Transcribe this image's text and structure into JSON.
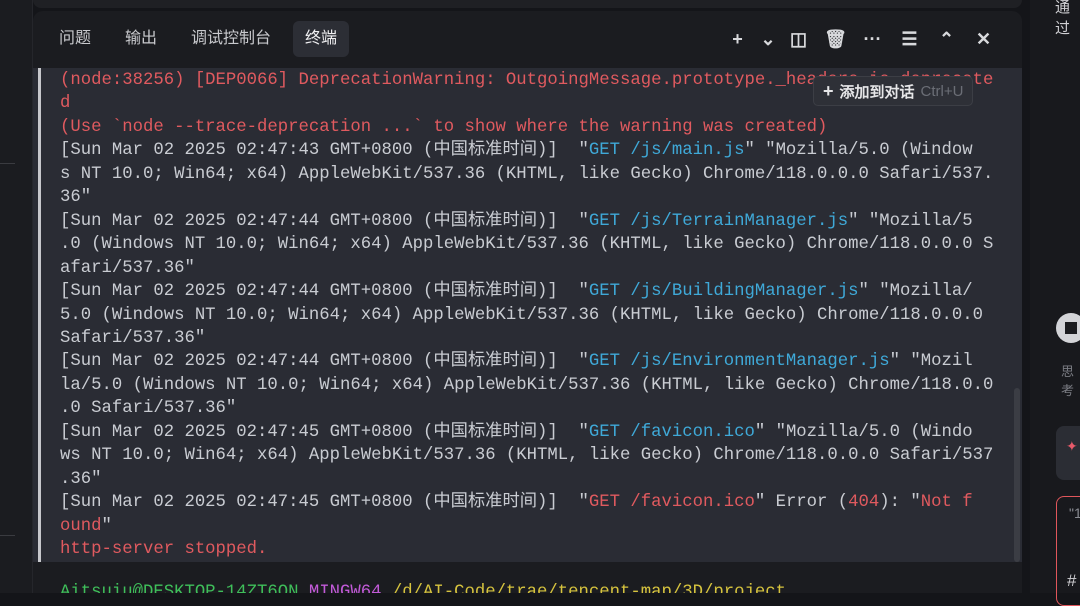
{
  "panel": {
    "tabs": [
      {
        "label": "问题",
        "active": false
      },
      {
        "label": "输出",
        "active": false
      },
      {
        "label": "调试控制台",
        "active": false
      },
      {
        "label": "终端",
        "active": true
      }
    ],
    "tools": [
      {
        "icon": "plus-icon",
        "glyph": "+"
      },
      {
        "icon": "chevron-down-icon",
        "glyph": "⌄"
      },
      {
        "icon": "split-icon",
        "glyph": "◫"
      },
      {
        "icon": "trash-icon",
        "glyph": "🗑"
      },
      {
        "icon": "more-icon",
        "glyph": "···"
      },
      {
        "icon": "settings-sliders-icon",
        "glyph": "☰"
      },
      {
        "icon": "chevron-up-icon",
        "glyph": "⌃"
      },
      {
        "icon": "close-icon",
        "glyph": "✕"
      }
    ]
  },
  "tooltip": {
    "plus": "+",
    "label": "添加到对话",
    "shortcut": "Ctrl+U"
  },
  "terminal": {
    "lines": [
      [
        {
          "t": "(node:38256) [DEP0066] DeprecationWarning: OutgoingMessage.prototype._headers is deprecate",
          "c": "r"
        }
      ],
      [
        {
          "t": "d",
          "c": "r"
        }
      ],
      [
        {
          "t": "(Use `node --trace-deprecation ...` to show where the warning was created)",
          "c": "r"
        }
      ],
      [
        {
          "t": "[Sun Mar 02 2025 02:47:43 GMT+0800 (中国标准时间)]  \"",
          "c": ""
        },
        {
          "t": "GET /js/main.js",
          "c": "c"
        },
        {
          "t": "\" \"Mozilla/5.0 (Window",
          "c": ""
        }
      ],
      [
        {
          "t": "s NT 10.0; Win64; x64) AppleWebKit/537.36 (KHTML, like Gecko) Chrome/118.0.0.0 Safari/537.",
          "c": ""
        }
      ],
      [
        {
          "t": "36\"",
          "c": ""
        }
      ],
      [
        {
          "t": "[Sun Mar 02 2025 02:47:44 GMT+0800 (中国标准时间)]  \"",
          "c": ""
        },
        {
          "t": "GET /js/TerrainManager.js",
          "c": "c"
        },
        {
          "t": "\" \"Mozilla/5",
          "c": ""
        }
      ],
      [
        {
          "t": ".0 (Windows NT 10.0; Win64; x64) AppleWebKit/537.36 (KHTML, like Gecko) Chrome/118.0.0.0 S",
          "c": ""
        }
      ],
      [
        {
          "t": "afari/537.36\"",
          "c": ""
        }
      ],
      [
        {
          "t": "[Sun Mar 02 2025 02:47:44 GMT+0800 (中国标准时间)]  \"",
          "c": ""
        },
        {
          "t": "GET /js/BuildingManager.js",
          "c": "c"
        },
        {
          "t": "\" \"Mozilla/",
          "c": ""
        }
      ],
      [
        {
          "t": "5.0 (Windows NT 10.0; Win64; x64) AppleWebKit/537.36 (KHTML, like Gecko) Chrome/118.0.0.0",
          "c": ""
        }
      ],
      [
        {
          "t": "Safari/537.36\"",
          "c": ""
        }
      ],
      [
        {
          "t": "[Sun Mar 02 2025 02:47:44 GMT+0800 (中国标准时间)]  \"",
          "c": ""
        },
        {
          "t": "GET /js/EnvironmentManager.js",
          "c": "c"
        },
        {
          "t": "\" \"Mozil",
          "c": ""
        }
      ],
      [
        {
          "t": "la/5.0 (Windows NT 10.0; Win64; x64) AppleWebKit/537.36 (KHTML, like Gecko) Chrome/118.0.0",
          "c": ""
        }
      ],
      [
        {
          "t": ".0 Safari/537.36\"",
          "c": ""
        }
      ],
      [
        {
          "t": "[Sun Mar 02 2025 02:47:45 GMT+0800 (中国标准时间)]  \"",
          "c": ""
        },
        {
          "t": "GET /favicon.ico",
          "c": "c"
        },
        {
          "t": "\" \"Mozilla/5.0 (Windo",
          "c": ""
        }
      ],
      [
        {
          "t": "ws NT 10.0; Win64; x64) AppleWebKit/537.36 (KHTML, like Gecko) Chrome/118.0.0.0 Safari/537",
          "c": ""
        }
      ],
      [
        {
          "t": ".36\"",
          "c": ""
        }
      ],
      [
        {
          "t": "[Sun Mar 02 2025 02:47:45 GMT+0800 (中国标准时间)]  \"",
          "c": ""
        },
        {
          "t": "GET /favicon.ico",
          "c": "r"
        },
        {
          "t": "\" Error (",
          "c": ""
        },
        {
          "t": "404",
          "c": "r"
        },
        {
          "t": "): \"",
          "c": ""
        },
        {
          "t": "Not f",
          "c": "r"
        }
      ],
      [
        {
          "t": "ound",
          "c": "r"
        },
        {
          "t": "\"",
          "c": ""
        }
      ],
      [
        {
          "t": "http-server stopped.",
          "c": "r"
        }
      ]
    ],
    "prompt": [
      {
        "t": "Aitsuiu@DESKTOP-14ZT6QN ",
        "c": "#3fbf5a"
      },
      {
        "t": "MINGW64 ",
        "c": "#c25ad8"
      },
      {
        "t": "/d/AI-Code/trae/tencent-map/3D/project",
        "c": "#d6c33e"
      }
    ]
  },
  "right_panel": {
    "top_text": "通过",
    "think_label": "思考",
    "card_text": "✦",
    "input_text": "\"1",
    "hash": "#"
  },
  "colors": {
    "error": "#e05a5f",
    "url": "#3fa9d8",
    "text": "#c9ccd2",
    "accent_border": "#e0565b"
  }
}
